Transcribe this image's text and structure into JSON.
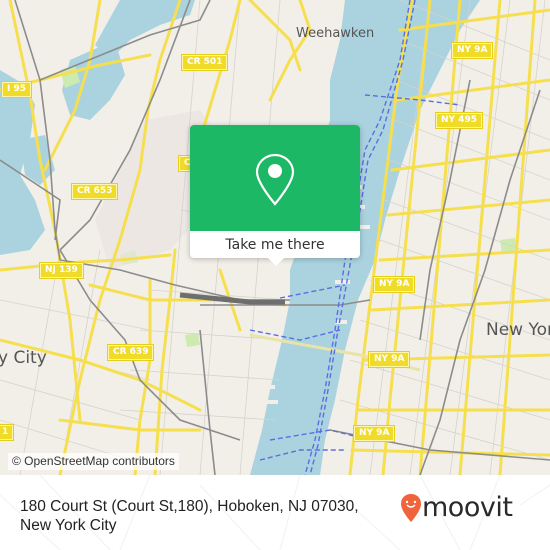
{
  "map": {
    "attribution": "© OpenStreetMap contributors",
    "colors": {
      "water": "#aad3df",
      "land": "#f2efe9",
      "road": "#f6df4f",
      "rail": "#8c8c8c",
      "ferry": "#5b6ee1",
      "park": "#cdebb0"
    },
    "place_labels": [
      {
        "id": "weehawken",
        "text": "Weehawken"
      },
      {
        "id": "new-york",
        "text": "New York"
      },
      {
        "id": "jersey-city",
        "text": "y City"
      }
    ],
    "shields": [
      {
        "id": "i95",
        "text": "I 95"
      },
      {
        "id": "cr501",
        "text": "CR 501"
      },
      {
        "id": "cr653",
        "text": "CR 653"
      },
      {
        "id": "cr-partial",
        "text": "C"
      },
      {
        "id": "nj139",
        "text": "NJ 139"
      },
      {
        "id": "cr639",
        "text": "CR 639"
      },
      {
        "id": "ny9a-1",
        "text": "NY 9A"
      },
      {
        "id": "ny495",
        "text": "NY 495"
      },
      {
        "id": "ny9a-2",
        "text": "NY 9A"
      },
      {
        "id": "ny9a-3",
        "text": "NY 9A"
      },
      {
        "id": "ny9a-4",
        "text": "NY 9A"
      },
      {
        "id": "partial-1",
        "text": "1"
      }
    ]
  },
  "popup": {
    "icon": "map-pin-icon",
    "button_label": "Take me there",
    "color": "#1db866"
  },
  "footer": {
    "address": "180 Court St (Court St,180), Hoboken, NJ 07030, New York City",
    "brand": "moovit",
    "brand_color": "#f0643c"
  }
}
